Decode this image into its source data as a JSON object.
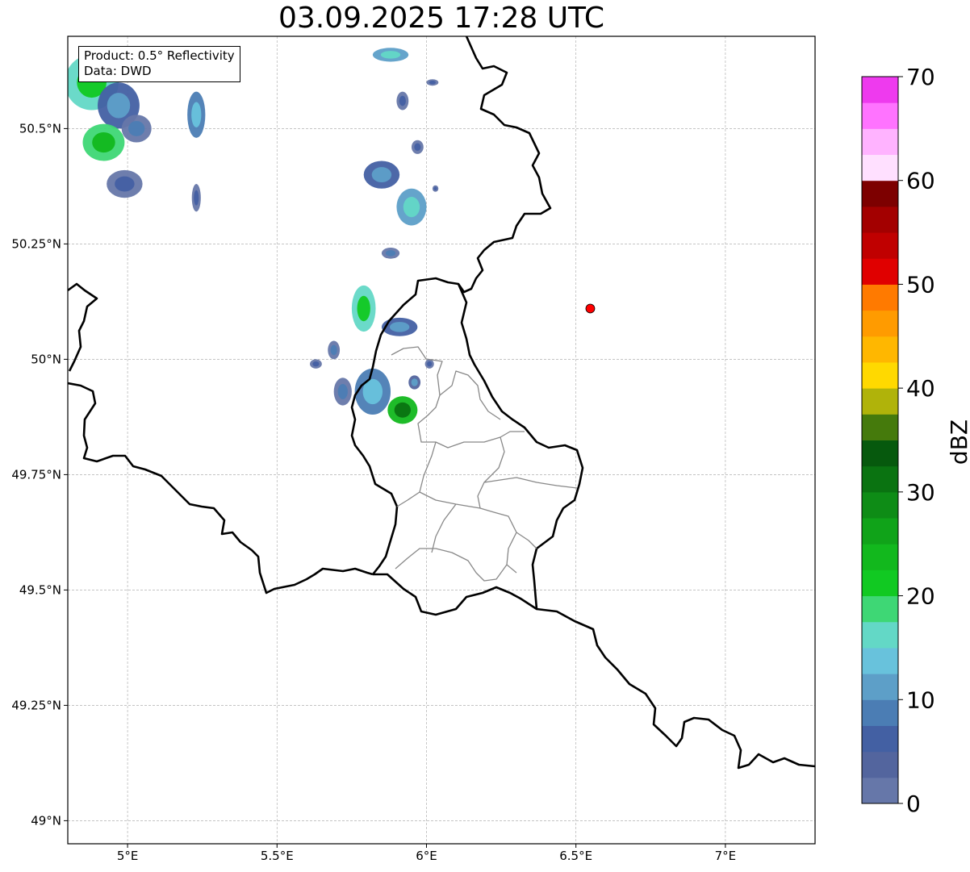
{
  "title": "03.09.2025 17:28 UTC",
  "info_box": {
    "product": "Product: 0.5° Reflectivity",
    "data": "Data: DWD"
  },
  "map": {
    "extent": {
      "lon": [
        4.8,
        7.3
      ],
      "lat": [
        48.95,
        50.7
      ]
    },
    "x_ticks": [
      {
        "value": 5.0,
        "label": "5°E"
      },
      {
        "value": 5.5,
        "label": "5.5°E"
      },
      {
        "value": 6.0,
        "label": "6°E"
      },
      {
        "value": 6.5,
        "label": "6.5°E"
      },
      {
        "value": 7.0,
        "label": "7°E"
      }
    ],
    "y_ticks": [
      {
        "value": 50.5,
        "label": "50.5°N"
      },
      {
        "value": 50.25,
        "label": "50.25°N"
      },
      {
        "value": 50.0,
        "label": "50°N"
      },
      {
        "value": 49.75,
        "label": "49.75°N"
      },
      {
        "value": 49.5,
        "label": "49.5°N"
      },
      {
        "value": 49.25,
        "label": "49.25°N"
      },
      {
        "value": 49.0,
        "label": "49°N"
      }
    ],
    "grid": true,
    "radar_site": {
      "lon": 6.548,
      "lat": 50.11,
      "color": "#ff0000"
    },
    "echoes": [
      {
        "lon": 4.88,
        "lat": 50.6,
        "dlon": 0.09,
        "dlat": 0.06,
        "dbz": 22
      },
      {
        "lon": 4.97,
        "lat": 50.55,
        "dlon": 0.07,
        "dlat": 0.05,
        "dbz": 12
      },
      {
        "lon": 4.92,
        "lat": 50.47,
        "dlon": 0.07,
        "dlat": 0.04,
        "dbz": 24
      },
      {
        "lon": 5.03,
        "lat": 50.5,
        "dlon": 0.05,
        "dlat": 0.03,
        "dbz": 8
      },
      {
        "lon": 4.99,
        "lat": 50.38,
        "dlon": 0.06,
        "dlat": 0.03,
        "dbz": 6
      },
      {
        "lon": 5.23,
        "lat": 50.53,
        "dlon": 0.03,
        "dlat": 0.05,
        "dbz": 14
      },
      {
        "lon": 5.23,
        "lat": 50.35,
        "dlon": 0.015,
        "dlat": 0.03,
        "dbz": 6
      },
      {
        "lon": 5.88,
        "lat": 50.66,
        "dlon": 0.06,
        "dlat": 0.015,
        "dbz": 16
      },
      {
        "lon": 5.92,
        "lat": 50.56,
        "dlon": 0.02,
        "dlat": 0.02,
        "dbz": 6
      },
      {
        "lon": 6.02,
        "lat": 50.6,
        "dlon": 0.02,
        "dlat": 0.007,
        "dbz": 6
      },
      {
        "lon": 5.97,
        "lat": 50.46,
        "dlon": 0.02,
        "dlat": 0.015,
        "dbz": 6
      },
      {
        "lon": 5.85,
        "lat": 50.4,
        "dlon": 0.06,
        "dlat": 0.03,
        "dbz": 12
      },
      {
        "lon": 5.95,
        "lat": 50.33,
        "dlon": 0.05,
        "dlat": 0.04,
        "dbz": 16
      },
      {
        "lon": 5.88,
        "lat": 50.23,
        "dlon": 0.03,
        "dlat": 0.012,
        "dbz": 8
      },
      {
        "lon": 6.03,
        "lat": 50.37,
        "dlon": 0.01,
        "dlat": 0.007,
        "dbz": 6
      },
      {
        "lon": 5.79,
        "lat": 50.11,
        "dlon": 0.04,
        "dlat": 0.05,
        "dbz": 22
      },
      {
        "lon": 5.91,
        "lat": 50.07,
        "dlon": 0.06,
        "dlat": 0.02,
        "dbz": 12
      },
      {
        "lon": 5.69,
        "lat": 50.02,
        "dlon": 0.02,
        "dlat": 0.02,
        "dbz": 8
      },
      {
        "lon": 5.63,
        "lat": 49.99,
        "dlon": 0.02,
        "dlat": 0.01,
        "dbz": 6
      },
      {
        "lon": 5.82,
        "lat": 49.93,
        "dlon": 0.06,
        "dlat": 0.05,
        "dbz": 14
      },
      {
        "lon": 5.92,
        "lat": 49.89,
        "dlon": 0.05,
        "dlat": 0.03,
        "dbz": 30
      },
      {
        "lon": 5.96,
        "lat": 49.95,
        "dlon": 0.02,
        "dlat": 0.015,
        "dbz": 10
      },
      {
        "lon": 6.01,
        "lat": 49.99,
        "dlon": 0.015,
        "dlat": 0.01,
        "dbz": 6
      },
      {
        "lon": 5.72,
        "lat": 49.93,
        "dlon": 0.03,
        "dlat": 0.03,
        "dbz": 8
      }
    ]
  },
  "colorbar": {
    "label": "dBZ",
    "min": 0,
    "max": 70,
    "ticks": [
      {
        "value": 0,
        "label": "0"
      },
      {
        "value": 10,
        "label": "10"
      },
      {
        "value": 20,
        "label": "20"
      },
      {
        "value": 30,
        "label": "30"
      },
      {
        "value": 40,
        "label": "40"
      },
      {
        "value": 50,
        "label": "50"
      },
      {
        "value": 60,
        "label": "60"
      },
      {
        "value": 70,
        "label": "70"
      }
    ],
    "colors": [
      "#6677a9",
      "#53659e",
      "#4360a3",
      "#4b7db4",
      "#5d9fc8",
      "#68c2dc",
      "#63d8c6",
      "#3ed775",
      "#11c922",
      "#12b81d",
      "#10a319",
      "#0e8c16",
      "#0a7311",
      "#06590d",
      "#457a0c",
      "#b0b30a",
      "#ffd900",
      "#ffb700",
      "#ff9b00",
      "#ff7a00",
      "#e00000",
      "#c00000",
      "#a30000",
      "#7d0000",
      "#ffe0ff",
      "#ffb3ff",
      "#ff73ff",
      "#ee3aee"
    ]
  }
}
